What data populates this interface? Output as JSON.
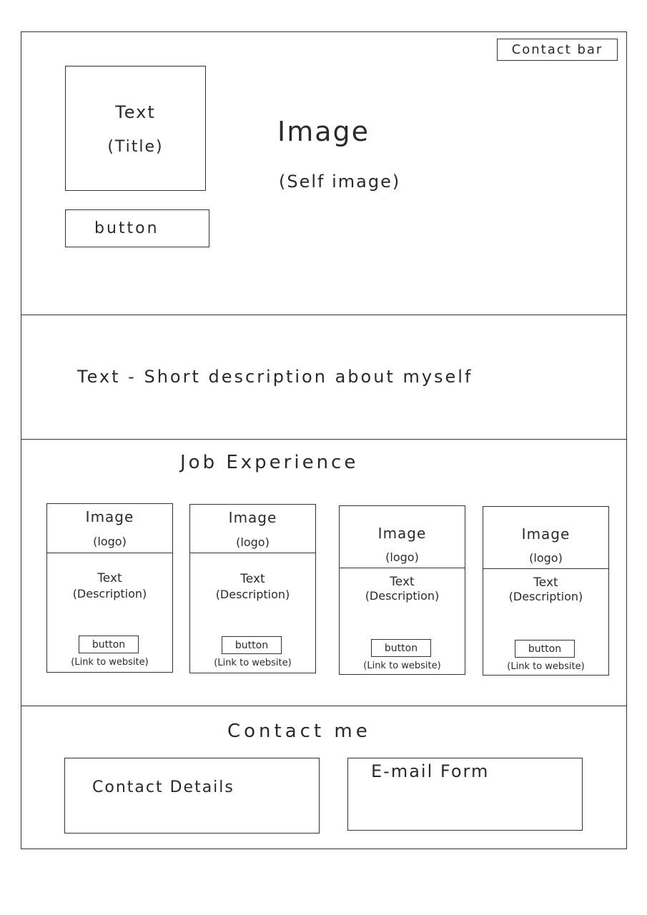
{
  "header": {
    "contact_bar": "Contact bar",
    "title_text": "Text",
    "title_sub": "(Title)",
    "button": "button",
    "image_text": "Image",
    "image_sub": "(Self image)"
  },
  "about": {
    "text": "Text - Short description about myself"
  },
  "jobs": {
    "title": "Job Experience",
    "cards": [
      {
        "image": "Image",
        "image_sub": "(logo)",
        "text": "Text",
        "text_sub": "(Description)",
        "button": "button",
        "link": "(Link to website)"
      },
      {
        "image": "Image",
        "image_sub": "(logo)",
        "text": "Text",
        "text_sub": "(Description)",
        "button": "button",
        "link": "(Link to website)"
      },
      {
        "image": "Image",
        "image_sub": "(logo)",
        "text": "Text",
        "text_sub": "(Description)",
        "button": "button",
        "link": "(Link to website)"
      },
      {
        "image": "Image",
        "image_sub": "(logo)",
        "text": "Text",
        "text_sub": "(Description)",
        "button": "button",
        "link": "(Link to website)"
      }
    ]
  },
  "contact": {
    "title": "Contact me",
    "details": "Contact Details",
    "email_form": "E-mail Form"
  }
}
